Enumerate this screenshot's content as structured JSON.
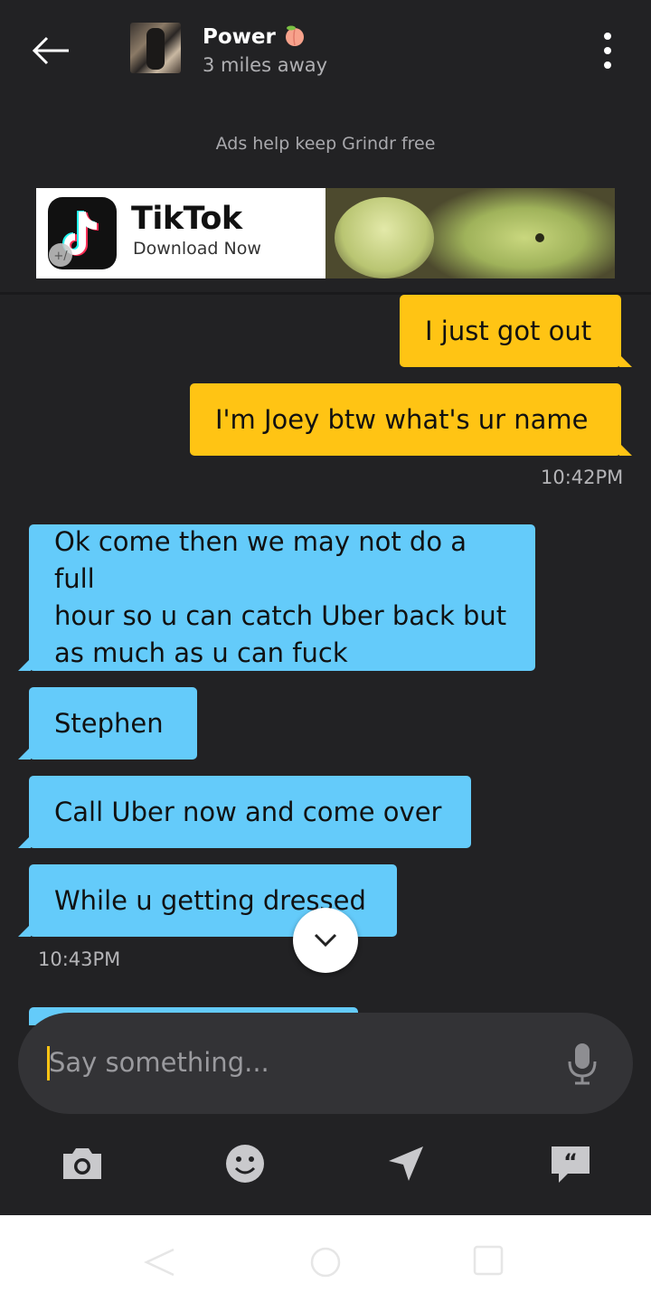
{
  "header": {
    "contact_name": "Power",
    "distance": "3 miles away"
  },
  "ad": {
    "note": "Ads help keep Grindr free",
    "brand": "TikTok",
    "cta": "Download Now"
  },
  "messages": [
    {
      "direction": "sent",
      "text": "I just got out"
    },
    {
      "direction": "sent",
      "text": "I'm Joey btw what's ur name"
    },
    {
      "direction": "timestamp",
      "text": "10:42PM"
    },
    {
      "direction": "received",
      "lines": [
        "Ok come then we may not do a full",
        "hour so u can catch Uber back but",
        "as much as u can fuck"
      ]
    },
    {
      "direction": "received",
      "text": "Stephen"
    },
    {
      "direction": "received",
      "text": "Call Uber now and come over"
    },
    {
      "direction": "received",
      "text": "While u getting dressed"
    },
    {
      "direction": "timestamp",
      "text": "10:43PM"
    }
  ],
  "input": {
    "placeholder": "Say something..."
  },
  "toolbar": {
    "icons": [
      "camera-icon",
      "emoji-icon",
      "location-icon",
      "saved-phrases-icon"
    ]
  },
  "colors": {
    "background": "#222224",
    "sent_bubble": "#ffc414",
    "received_bubble": "#64cbfa"
  }
}
